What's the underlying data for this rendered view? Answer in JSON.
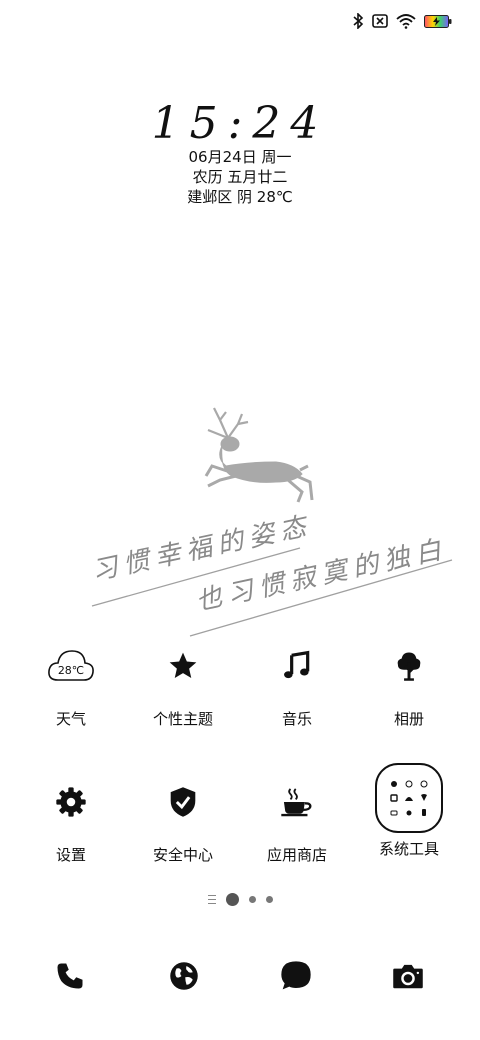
{
  "status_bar": {
    "icons": [
      "bluetooth-icon",
      "sim-off-icon",
      "wifi-icon",
      "battery-charging-icon"
    ]
  },
  "lockscreen": {
    "time": "15:24",
    "date": "06月24日 周一",
    "lunar": "农历 五月廿二",
    "weather": "建邺区 阴 28℃"
  },
  "wallpaper": {
    "line1": "习惯幸福的姿态",
    "line2": "也习惯寂寞的独白"
  },
  "apps": [
    {
      "label": "天气",
      "icon": "weather-cloud-icon",
      "temp": "28℃"
    },
    {
      "label": "个性主题",
      "icon": "star-icon"
    },
    {
      "label": "音乐",
      "icon": "music-note-icon"
    },
    {
      "label": "相册",
      "icon": "tree-icon"
    },
    {
      "label": "设置",
      "icon": "gear-icon"
    },
    {
      "label": "安全中心",
      "icon": "shield-check-icon"
    },
    {
      "label": "应用商店",
      "icon": "coffee-cup-icon"
    },
    {
      "label": "系统工具",
      "icon": "folder-icon"
    }
  ],
  "page_indicator": {
    "pages": 3,
    "current": 1
  },
  "dock": [
    {
      "icon": "phone-icon"
    },
    {
      "icon": "browser-globe-icon"
    },
    {
      "icon": "message-icon"
    },
    {
      "icon": "camera-icon"
    }
  ],
  "colors": {
    "text": "#111111",
    "accent_grey": "#9a9a9a",
    "battery_gradient": [
      "#ff4d6d",
      "#ffd400",
      "#3ed16b",
      "#7b5cff"
    ]
  }
}
